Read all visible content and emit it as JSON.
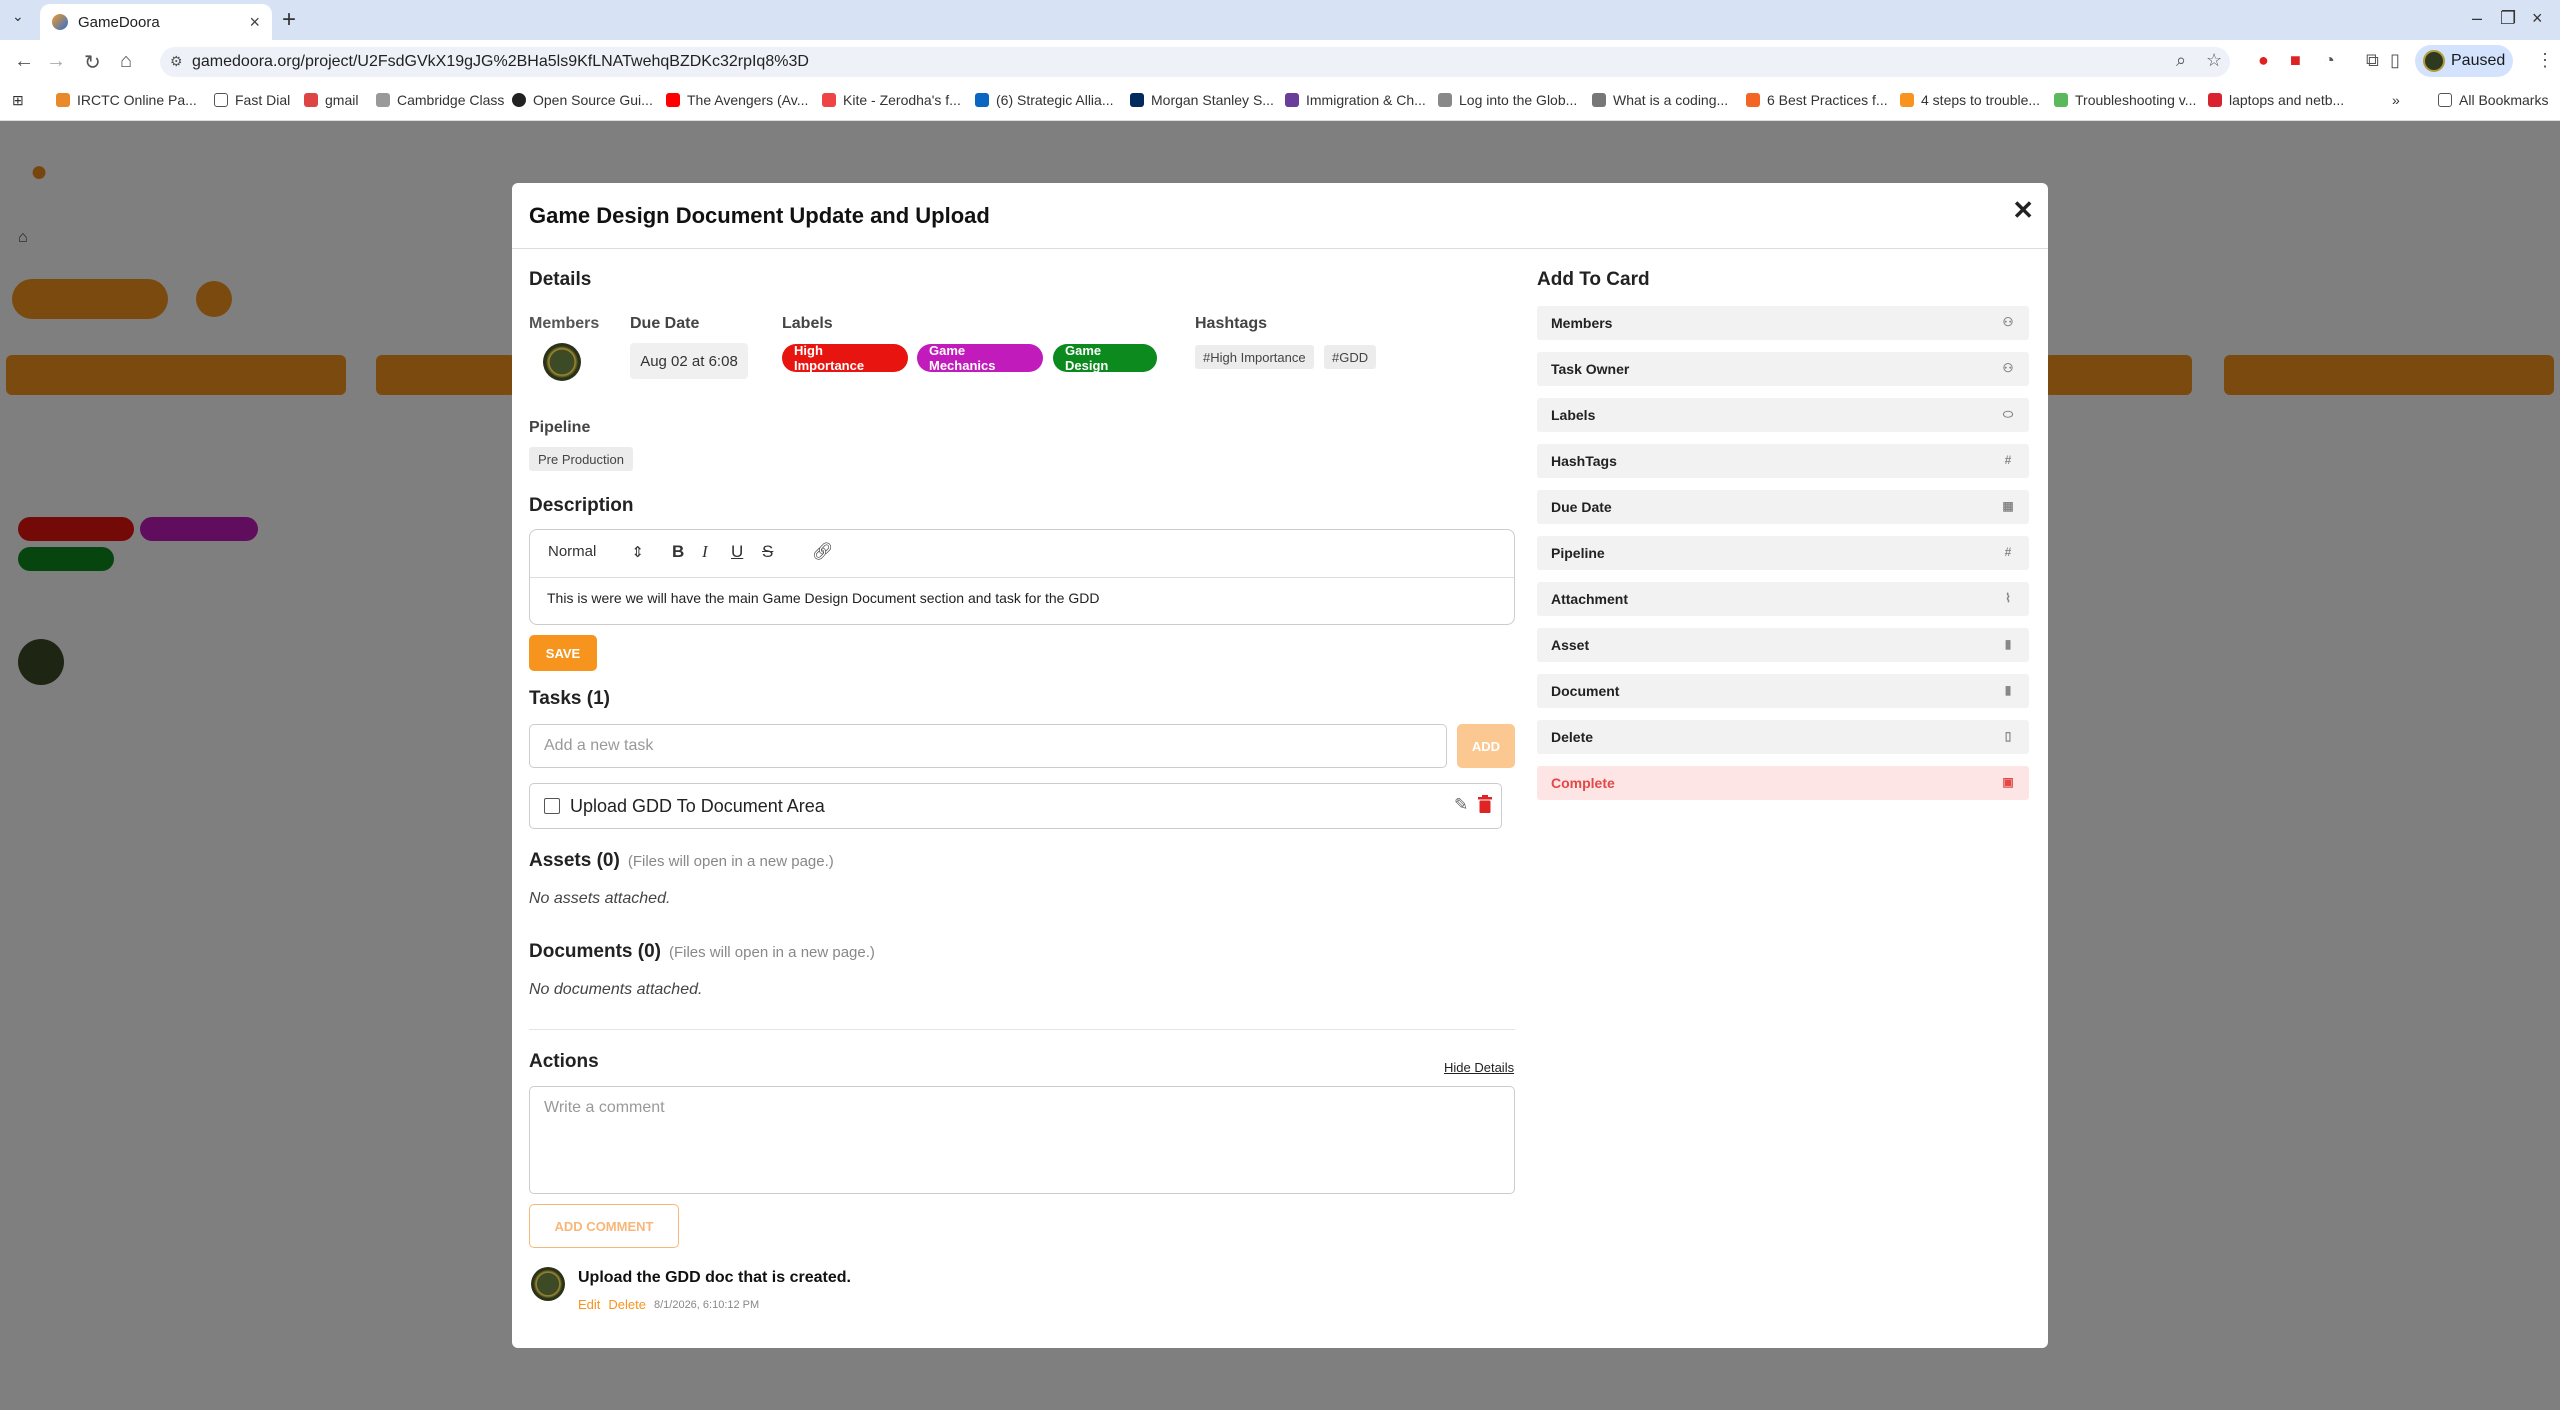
{
  "browser": {
    "tab_title": "GameDoora",
    "url": "gamedoora.org/project/U2FsdGVkX19gJG%2BHa5ls9KfLNATwehqBZDKc32rpIq8%3D",
    "profile_label": "Paused",
    "bookmarks": [
      "IRCTC Online Pa...",
      "Fast Dial",
      "gmail",
      "Cambridge Class",
      "Open Source Gui...",
      "The Avengers (Av...",
      "Kite - Zerodha's f...",
      "(6) Strategic Allia...",
      "Morgan Stanley S...",
      "Immigration & Ch...",
      "Log into the Glob...",
      "What is a coding...",
      "6 Best Practices f...",
      "4 steps to trouble...",
      "Troubleshooting v...",
      "laptops and netb..."
    ],
    "all_bookmarks": "All Bookmarks"
  },
  "modal": {
    "title": "Game Design Document Update and Upload",
    "details_heading": "Details",
    "members_label": "Members",
    "due_label": "Due Date",
    "due_value": "Aug 02 at 6:08",
    "labels_label": "Labels",
    "labels": [
      {
        "text": "High Importance",
        "color": "#e8140f"
      },
      {
        "text": "Game Mechanics",
        "color": "#c21bbb"
      },
      {
        "text": "Game Design",
        "color": "#0c8a1d"
      }
    ],
    "hashtags_label": "Hashtags",
    "hashtags": [
      "#High Importance",
      "#GDD"
    ],
    "pipeline_label": "Pipeline",
    "pipeline_value": "Pre Production",
    "description_heading": "Description",
    "editor_format": "Normal",
    "description_text": "This is were we will have the main Game Design Document section and task for the GDD",
    "save_label": "SAVE",
    "tasks_heading": "Tasks (1)",
    "task_placeholder": "Add a new task",
    "add_label": "ADD",
    "tasks": [
      {
        "text": "Upload GDD To Document Area",
        "done": false
      }
    ],
    "assets_heading": "Assets (0)",
    "assets_note": "(Files will open in a new page.)",
    "assets_empty": "No assets attached.",
    "documents_heading": "Documents (0)",
    "documents_note": "(Files will open in a new page.)",
    "documents_empty": "No documents attached.",
    "actions_heading": "Actions",
    "hide_details": "Hide Details",
    "comment_placeholder": "Write a comment",
    "add_comment_label": "ADD COMMENT",
    "comment": {
      "text": "Upload the GDD doc that is created.",
      "edit": "Edit",
      "delete": "Delete",
      "timestamp": "8/1/2026, 6:10:12 PM"
    },
    "add_to_card_heading": "Add To Card",
    "add_to_card": [
      {
        "label": "Members",
        "icon": "person-icon"
      },
      {
        "label": "Task Owner",
        "icon": "person-icon"
      },
      {
        "label": "Labels",
        "icon": "tag-icon"
      },
      {
        "label": "HashTags",
        "icon": "hash-icon"
      },
      {
        "label": "Due Date",
        "icon": "calendar-icon"
      },
      {
        "label": "Pipeline",
        "icon": "hash-icon"
      },
      {
        "label": "Attachment",
        "icon": "paperclip-icon"
      },
      {
        "label": "Asset",
        "icon": "file-icon"
      },
      {
        "label": "Document",
        "icon": "file-icon"
      },
      {
        "label": "Delete",
        "icon": "trash-icon"
      },
      {
        "label": "Complete",
        "icon": "clipboard-check-icon"
      }
    ]
  },
  "colors": {
    "accent": "#f7941d",
    "complete_bg": "#fde5e5",
    "complete_text": "#e34848"
  }
}
